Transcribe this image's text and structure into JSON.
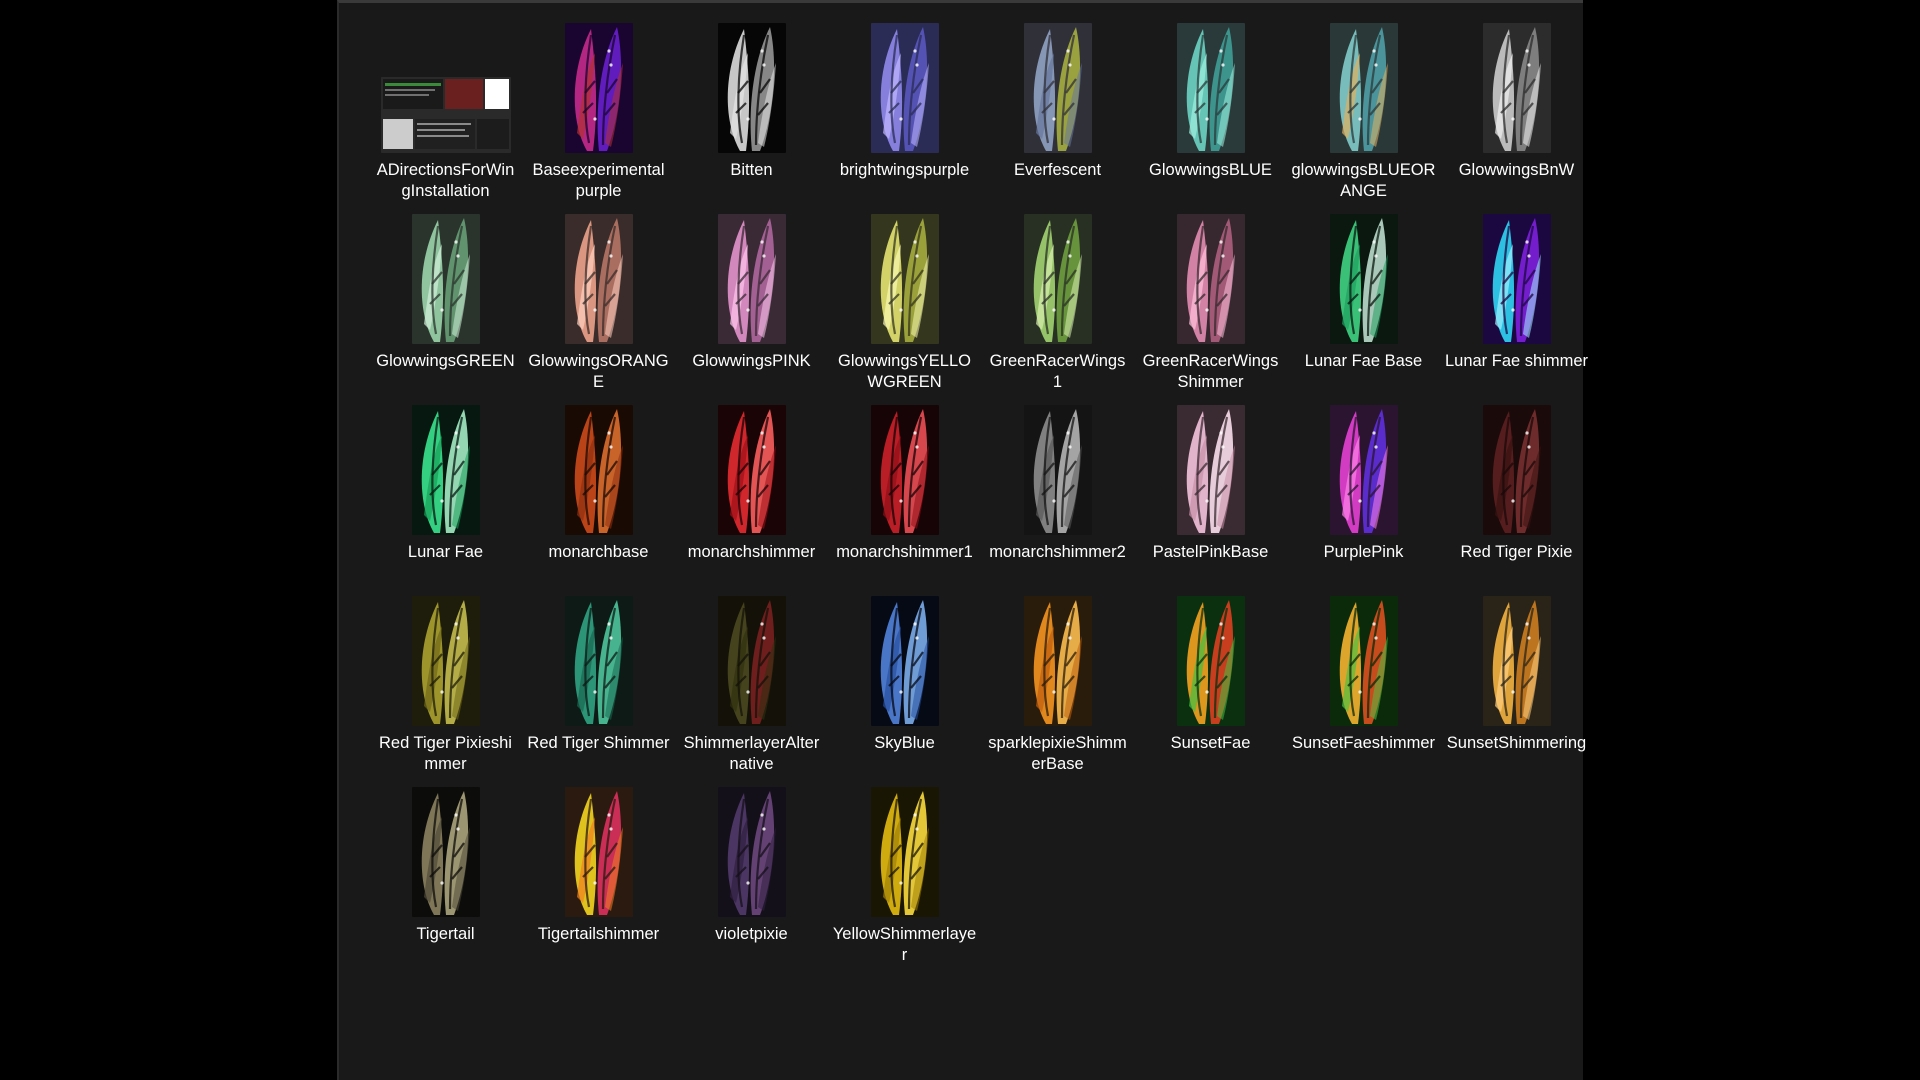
{
  "explorer": {
    "files": [
      {
        "name": "ADirectionsForWingInstallation",
        "thumb": "document",
        "colors": [
          "#6b2020",
          "#3a8a3a",
          "#ffffff",
          "#cccccc"
        ]
      },
      {
        "name": "Baseexperimental purple",
        "thumb": "wing",
        "colors": [
          "#1a0530",
          "#c02a8a",
          "#6a20d0",
          "#b03030"
        ]
      },
      {
        "name": "Bitten",
        "thumb": "wing",
        "colors": [
          "#060606",
          "#d8d8d8",
          "#9a9a9a",
          "#e6e6e6"
        ]
      },
      {
        "name": "brightwingspurple",
        "thumb": "wing",
        "colors": [
          "#2a2c55",
          "#8e88e8",
          "#5a58c0",
          "#c0b8ff"
        ]
      },
      {
        "name": "Everfescent",
        "thumb": "wing",
        "colors": [
          "#303038",
          "#8ea0c0",
          "#a8b040",
          "#6878a0"
        ]
      },
      {
        "name": "GlowwingsBLUE",
        "thumb": "wing",
        "colors": [
          "#2a3a3a",
          "#6ad0c0",
          "#40a098",
          "#a0f0e0"
        ]
      },
      {
        "name": "glowwingsBLUEORANGE",
        "thumb": "wing",
        "colors": [
          "#2a3838",
          "#80c8c8",
          "#50a0a8",
          "#e0b060"
        ]
      },
      {
        "name": "GlowwingsBnW",
        "thumb": "wing",
        "colors": [
          "#2c2c2c",
          "#c8c8c8",
          "#8a8a8a",
          "#f0f0f0"
        ]
      },
      {
        "name": "GlowwingsGREEN",
        "thumb": "wing",
        "colors": [
          "#2a342c",
          "#98d0a8",
          "#68a078",
          "#d0f0d8"
        ]
      },
      {
        "name": "GlowwingsORANGE",
        "thumb": "wing",
        "colors": [
          "#3a2c2a",
          "#e8a088",
          "#b87868",
          "#ffd0c0"
        ]
      },
      {
        "name": "GlowwingsPINK",
        "thumb": "wing",
        "colors": [
          "#3a2a36",
          "#e090c8",
          "#b068a0",
          "#ffc8ee"
        ]
      },
      {
        "name": "GlowwingsYELLOWGREEN",
        "thumb": "wing",
        "colors": [
          "#34361e",
          "#e0e070",
          "#a8b040",
          "#f8f8b0"
        ]
      },
      {
        "name": "GreenRacerWings1",
        "thumb": "wing",
        "colors": [
          "#283024",
          "#a0d070",
          "#70a040",
          "#d8f0b0"
        ]
      },
      {
        "name": "GreenRacerWingsShimmer",
        "thumb": "wing",
        "colors": [
          "#36282e",
          "#e08ab0",
          "#b06080",
          "#ffc0dc"
        ]
      },
      {
        "name": "Lunar Fae Base",
        "thumb": "wing",
        "colors": [
          "#0a1810",
          "#40d080",
          "#c0e0d0",
          "#20a060"
        ]
      },
      {
        "name": "Lunar Fae shimmer",
        "thumb": "wing",
        "colors": [
          "#1c0840",
          "#30d0f0",
          "#8020e0",
          "#a0f0ff"
        ]
      },
      {
        "name": "Lunar Fae",
        "thumb": "wing",
        "colors": [
          "#061810",
          "#38e08a",
          "#a8f0c8",
          "#18a058"
        ]
      },
      {
        "name": "monarchbase",
        "thumb": "wing",
        "colors": [
          "#1a0a04",
          "#c84a1a",
          "#e07030",
          "#903010"
        ]
      },
      {
        "name": "monarchshimmer",
        "thumb": "wing",
        "colors": [
          "#1a0406",
          "#e02a30",
          "#ff6060",
          "#a01018"
        ]
      },
      {
        "name": "monarchshimmer1",
        "thumb": "wing",
        "colors": [
          "#160406",
          "#c82028",
          "#f05058",
          "#901018"
        ]
      },
      {
        "name": "monarchshimmer2",
        "thumb": "wing",
        "colors": [
          "#141414",
          "#8a8a8a",
          "#b8b8b8",
          "#5a5a5a"
        ]
      },
      {
        "name": "PastelPinkBase",
        "thumb": "wing",
        "colors": [
          "#3a2a32",
          "#f0c0d8",
          "#ffe4f0",
          "#c890a8"
        ]
      },
      {
        "name": "PurplePink",
        "thumb": "wing",
        "colors": [
          "#2a1430",
          "#e040d0",
          "#6030e0",
          "#ff80e8"
        ]
      },
      {
        "name": "Red Tiger Pixie",
        "thumb": "wing",
        "colors": [
          "#1a0a0a",
          "#5a2020",
          "#7a3030",
          "#3a1212"
        ]
      },
      {
        "name": "Red Tiger Pixieshimmer",
        "thumb": "wing",
        "colors": [
          "#1e1c0a",
          "#a8a030",
          "#c8c050",
          "#706818"
        ]
      },
      {
        "name": "Red Tiger Shimmer",
        "thumb": "wing",
        "colors": [
          "#0e1a16",
          "#30a080",
          "#50c8a0",
          "#1a6850"
        ]
      },
      {
        "name": "ShimmerlayerAlternative",
        "thumb": "wing",
        "colors": [
          "#141208",
          "#4a4820",
          "#7a2020",
          "#303010"
        ]
      },
      {
        "name": "SkyBlue",
        "thumb": "wing",
        "colors": [
          "#060a14",
          "#5080d8",
          "#80b0f0",
          "#2850a0"
        ]
      },
      {
        "name": "sparklepixieShimmerBase",
        "thumb": "wing",
        "colors": [
          "#2a1c0a",
          "#f09020",
          "#ffc050",
          "#c06010"
        ]
      },
      {
        "name": "SunsetFae",
        "thumb": "wing",
        "colors": [
          "#0a3010",
          "#f0a020",
          "#e04020",
          "#40c040"
        ]
      },
      {
        "name": "SunsetFaeshimmer",
        "thumb": "wing",
        "colors": [
          "#0a2a0a",
          "#f0b030",
          "#e05020",
          "#50c040"
        ]
      },
      {
        "name": "SunsetShimmering",
        "thumb": "wing",
        "colors": [
          "#2a2418",
          "#f0b040",
          "#d08020",
          "#ffd080"
        ]
      },
      {
        "name": "Tigertail",
        "thumb": "wing",
        "colors": [
          "#0c0c0a",
          "#8a8060",
          "#b0a880",
          "#504a38"
        ]
      },
      {
        "name": "Tigertailshimmer",
        "thumb": "wing",
        "colors": [
          "#2a1a10",
          "#f0d020",
          "#e03060",
          "#f08020"
        ]
      },
      {
        "name": "violetpixie",
        "thumb": "wing",
        "colors": [
          "#14101a",
          "#503868",
          "#704880",
          "#302040"
        ]
      },
      {
        "name": "YellowShimmerlayer",
        "thumb": "wing",
        "colors": [
          "#1a1604",
          "#e0b810",
          "#ffe040",
          "#a08008"
        ]
      }
    ]
  }
}
